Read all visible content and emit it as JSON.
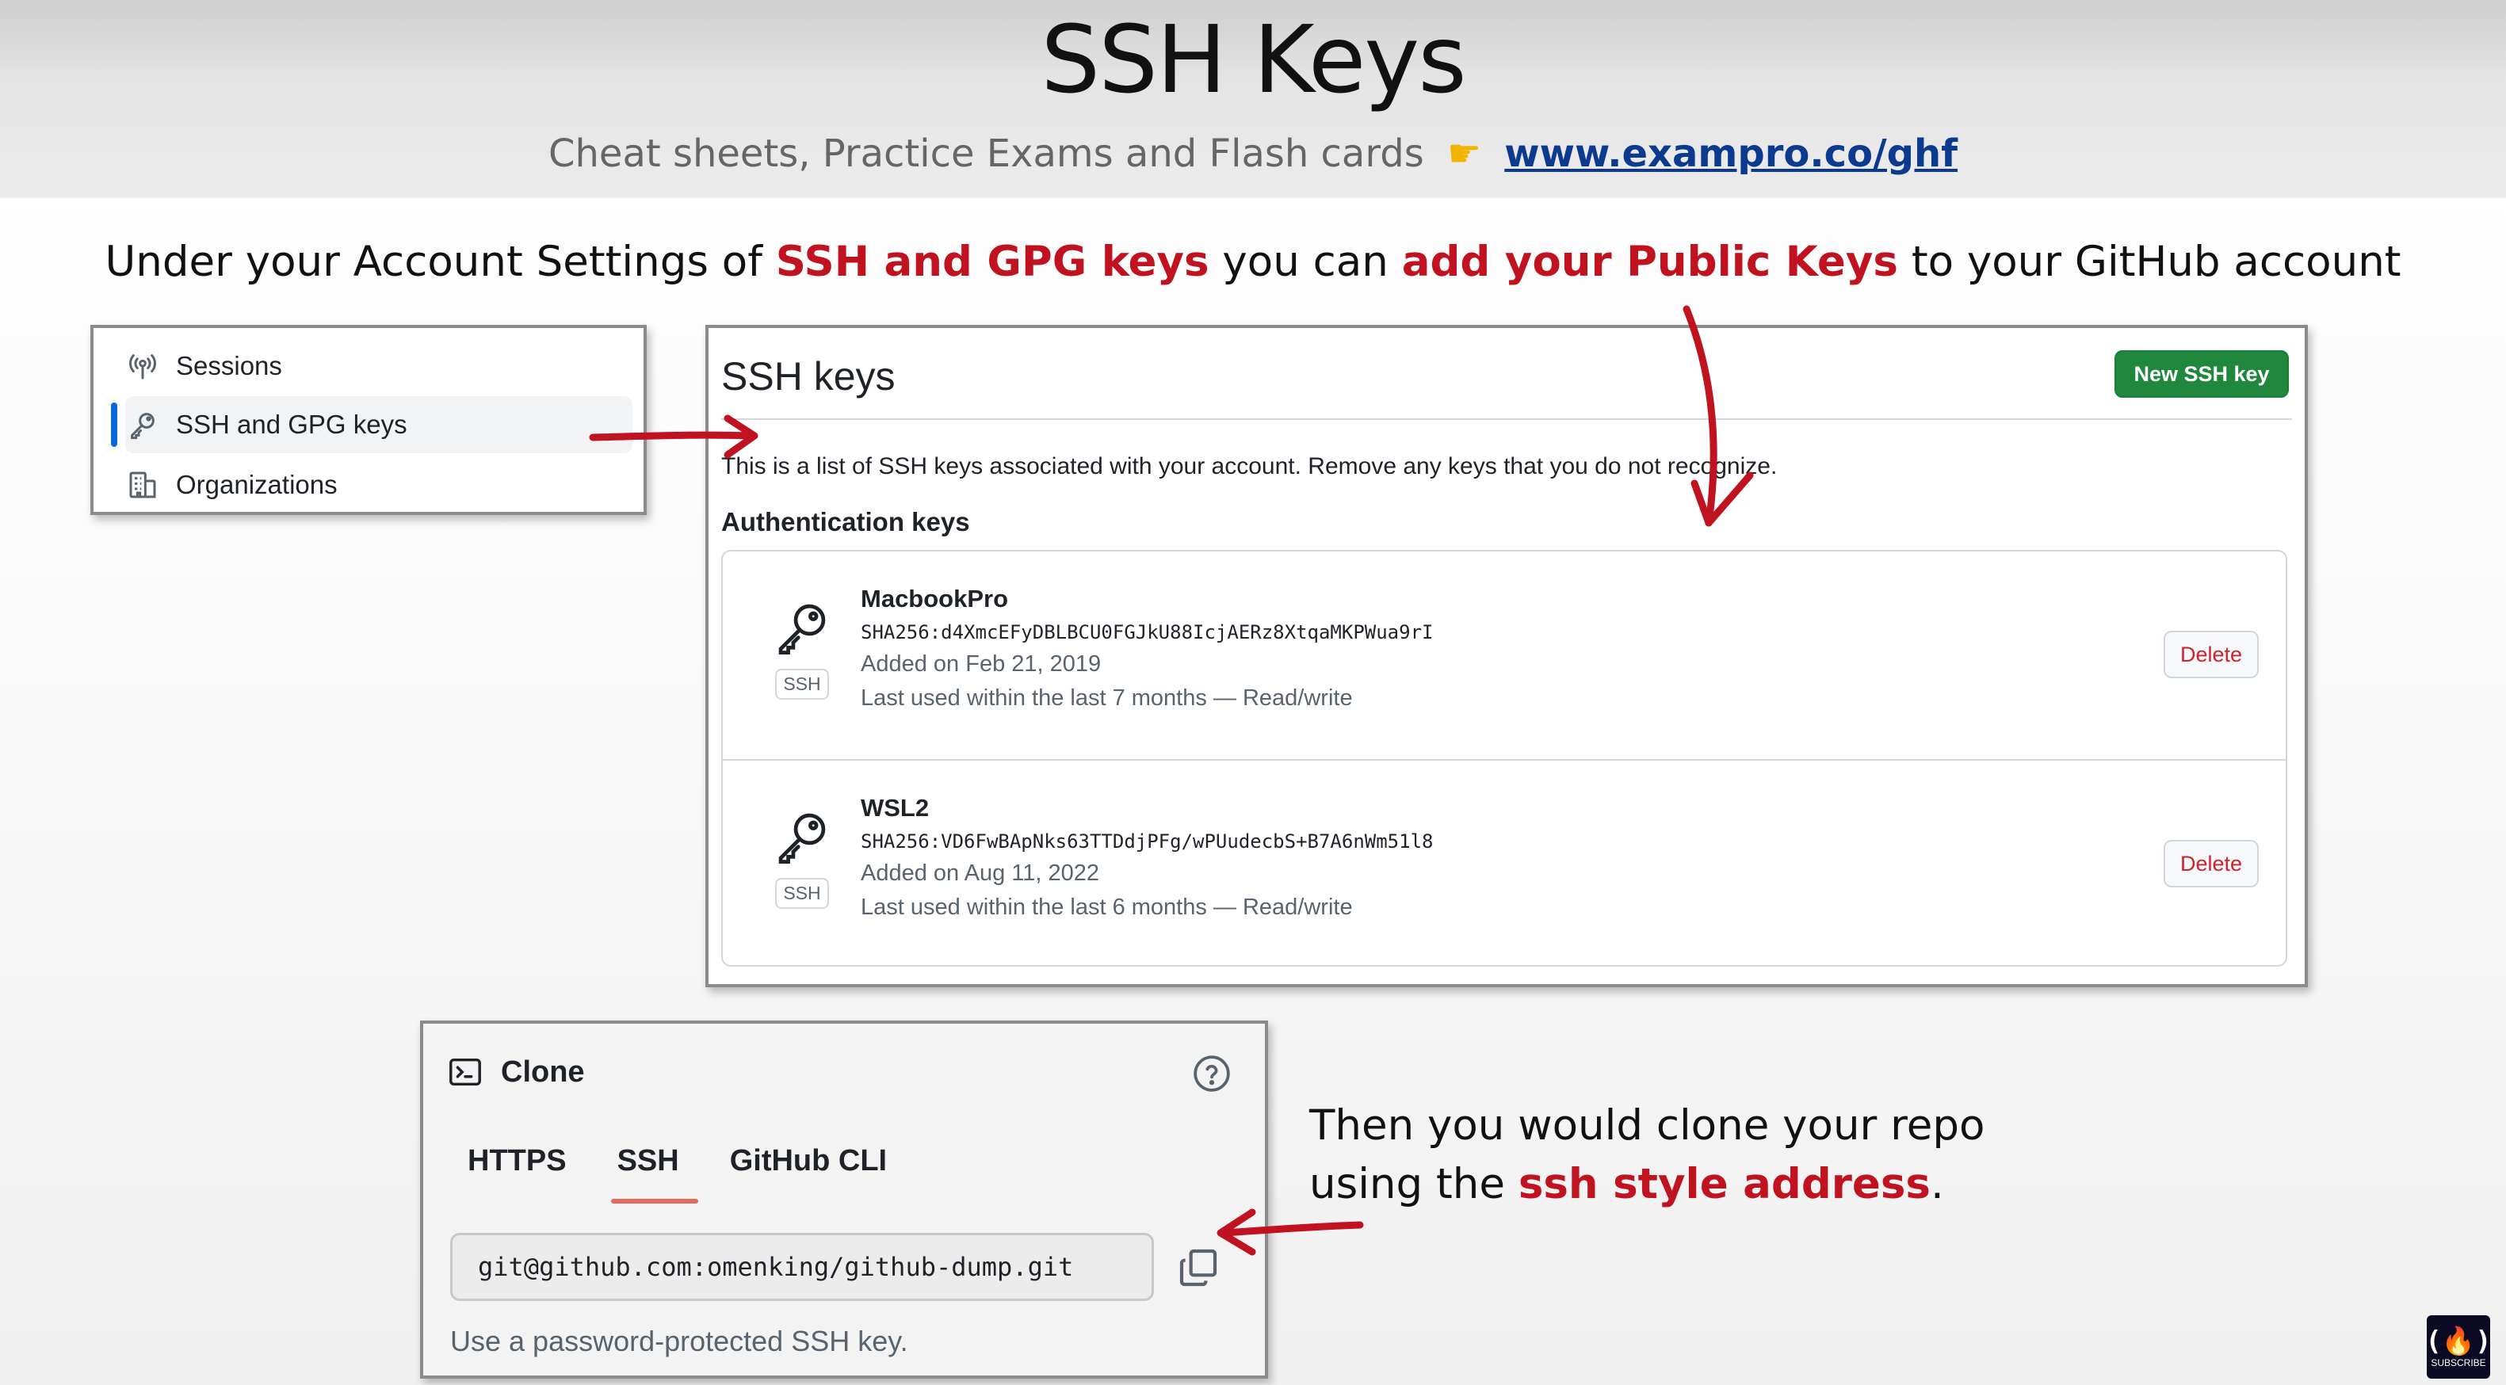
{
  "slide": {
    "title": "SSH Keys",
    "promo_text": "Cheat sheets, Practice Exams and Flash cards",
    "promo_icon": "pointing-hand",
    "promo_link": "www.exampro.co/ghf"
  },
  "caption": {
    "part1": "Under your Account Settings of ",
    "highlight1": "SSH and GPG keys",
    "part2": " you can ",
    "highlight2": "add your Public Keys",
    "part3": " to your GitHub account"
  },
  "sidebar": {
    "items": [
      {
        "label": "Sessions",
        "icon": "broadcast-icon"
      },
      {
        "label": "SSH and GPG keys",
        "icon": "key-icon",
        "active": true
      },
      {
        "label": "Organizations",
        "icon": "organization-icon"
      }
    ]
  },
  "ssh_panel": {
    "heading": "SSH keys",
    "new_key_button": "New SSH key",
    "description": "This is a list of SSH keys associated with your account. Remove any keys that you do not recognize.",
    "auth_heading": "Authentication keys",
    "keys": [
      {
        "name": "MacbookPro",
        "fingerprint": "SHA256:d4XmcEFyDBLBCU0FGJkU88IcjAERz8XtqaMKPWua9rI",
        "added": "Added on Feb 21, 2019",
        "last_used": "Last used within the last 7 months — Read/write",
        "badge": "SSH",
        "delete_label": "Delete"
      },
      {
        "name": "WSL2",
        "fingerprint": "SHA256:VD6FwBApNks63TTDdjPFg/wPUudecbS+B7A6nWm51l8",
        "added": "Added on Aug 11, 2022",
        "last_used": "Last used within the last 6 months — Read/write",
        "badge": "SSH",
        "delete_label": "Delete"
      }
    ]
  },
  "clone": {
    "title": "Clone",
    "tabs": [
      {
        "label": "HTTPS"
      },
      {
        "label": "SSH",
        "active": true
      },
      {
        "label": "GitHub CLI"
      }
    ],
    "url": "git@github.com:omenking/github-dump.git",
    "note": "Use a password-protected SSH key."
  },
  "explain": {
    "line1": "Then you would clone your repo",
    "line2_prefix": "using the ",
    "line2_highlight": "ssh style address",
    "line2_suffix": "."
  },
  "logo": {
    "mark": "(🔥)",
    "sub": "SUBSCRIBE"
  },
  "colors": {
    "highlight": "#c0121f",
    "arrow": "#c0121f",
    "primary_button": "#1f883d",
    "active_bar": "#0969da",
    "danger": "#cf222e"
  }
}
